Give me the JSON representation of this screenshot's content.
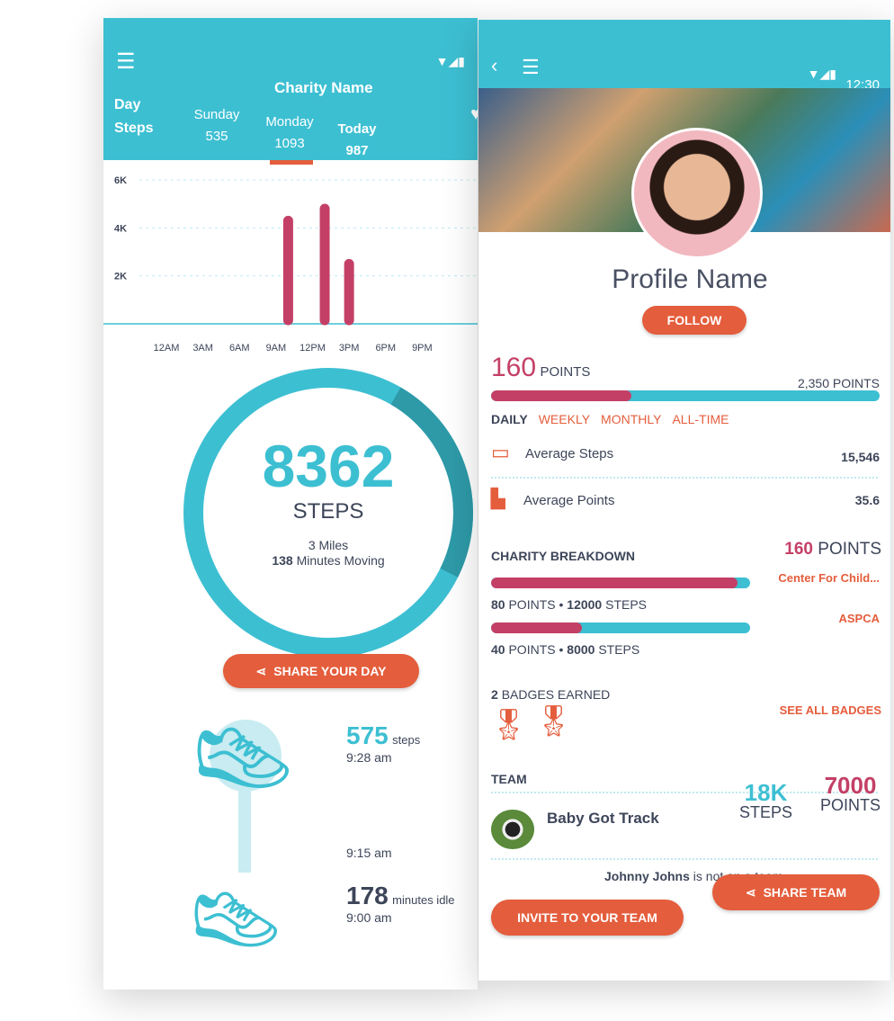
{
  "left": {
    "title": "Charity Name",
    "row_label": [
      "Day",
      "Steps"
    ],
    "days": [
      {
        "day": "Sunday",
        "steps": "535"
      },
      {
        "day": "Monday",
        "steps": "1093"
      },
      {
        "day": "Today",
        "steps": "987"
      }
    ],
    "selected_day": "Monday",
    "steps_total": "8362",
    "steps_label": "STEPS",
    "miles": "3 Miles",
    "minutes_value": "138",
    "minutes_label": "Minutes Moving",
    "progress_fraction": 0.96,
    "share_day": "SHARE YOUR DAY",
    "timeline": [
      {
        "value": "575",
        "unit": "steps",
        "time": "9:28 am"
      },
      {
        "time": "9:15 am"
      },
      {
        "value": "178",
        "unit": "minutes idle",
        "time": "9:00 am"
      }
    ]
  },
  "chart_data": {
    "type": "bar",
    "y_ticks": [
      "6K",
      "4K",
      "2K"
    ],
    "x_ticks": [
      "12AM",
      "3AM",
      "6AM",
      "9AM",
      "12PM",
      "3PM",
      "6PM",
      "9PM"
    ],
    "ylim": [
      0,
      6000
    ],
    "x": [
      10,
      13,
      15
    ],
    "values": [
      4300,
      4800,
      2500
    ],
    "grid": true,
    "bar_color": "#c43f66"
  },
  "right": {
    "time": "12:30",
    "profile_name": "Profile Name",
    "follow": "FOLLOW",
    "points": "160",
    "points_unit": "POINTS",
    "goal": "2,350 POINTS",
    "points_fraction": 0.36,
    "tabs": [
      "DAILY",
      "WEEKLY",
      "MONTHLY",
      "ALL-TIME"
    ],
    "stats": [
      {
        "label": "Average Steps",
        "value": "15,546",
        "icon": "calendar-icon"
      },
      {
        "label": "Average Points",
        "value": "35.6",
        "icon": "bar-chart-icon"
      }
    ],
    "charity_title": "CHARITY BREAKDOWN",
    "charity_total": "160",
    "charity_total_unit": "POINTS",
    "charities": [
      {
        "name": "Center For Child...",
        "points": "80",
        "points_unit": "POINTS",
        "steps": "12000",
        "steps_unit": "STEPS",
        "fraction": 0.95
      },
      {
        "name": "ASPCA",
        "points": "40",
        "points_unit": "POINTS",
        "steps": "8000",
        "steps_unit": "STEPS",
        "fraction": 0.35
      }
    ],
    "badges_count": "2",
    "badges_label": "BADGES EARNED",
    "see_all": "SEE ALL BADGES",
    "team_title": "TEAM",
    "team_name": "Baby Got Track",
    "team_steps": "18K",
    "team_steps_label": "STEPS",
    "team_points": "7000",
    "team_points_label": "POINTS",
    "user_name": "Johnny Johns",
    "user_msg": "is not on a team",
    "invite": "INVITE TO YOUR TEAM",
    "share_team": "SHARE TEAM"
  },
  "colors": {
    "teal": "#3dbfd2",
    "orange": "#e45d3c",
    "pink": "#c43f66",
    "text": "#3d4559"
  }
}
